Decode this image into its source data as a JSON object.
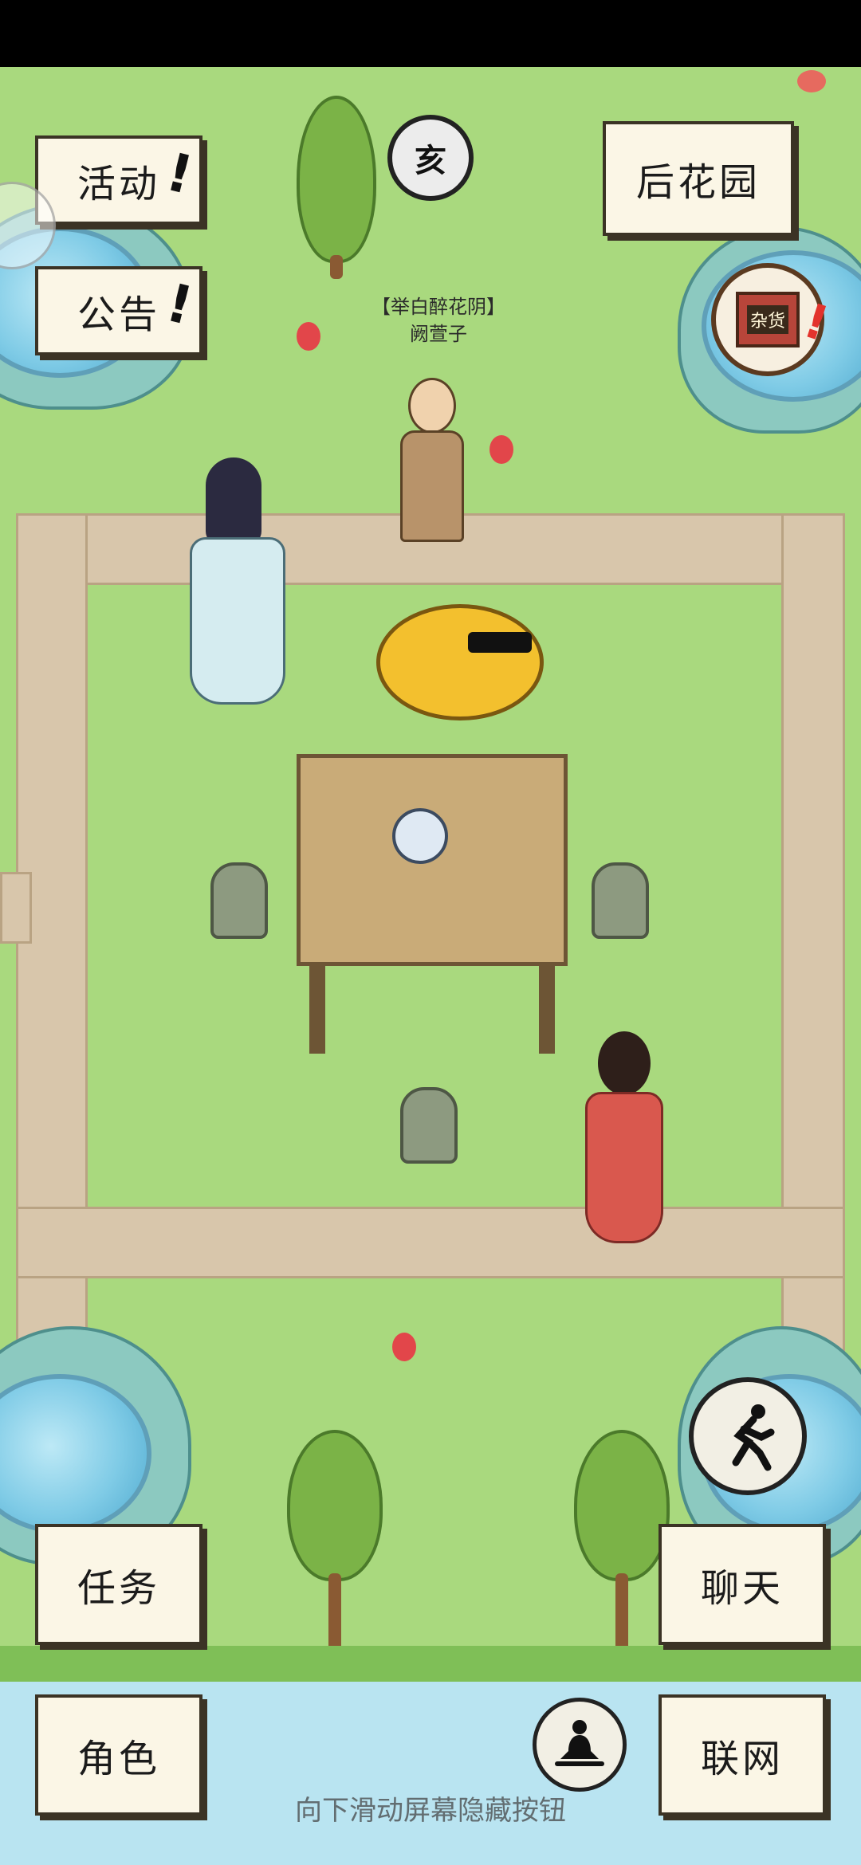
{
  "buttons": {
    "activity": "活动",
    "announcement": "公告",
    "back_garden": "后花园",
    "task": "任务",
    "chat": "聊天",
    "character": "角色",
    "network": "联网"
  },
  "zodiac_badge": "亥",
  "shop_sign": "杂货",
  "npc": {
    "title": "【举白醉花阴】",
    "name": "阙萱子"
  },
  "hint": "向下滑动屏幕隐藏按钮",
  "icons": {
    "exclaim": "!",
    "run": "running-man-icon",
    "meditate": "meditation-icon"
  },
  "colors": {
    "grass": "#a9d97e",
    "path": "#d8c6ab",
    "button_bg": "#fbf6e6"
  }
}
